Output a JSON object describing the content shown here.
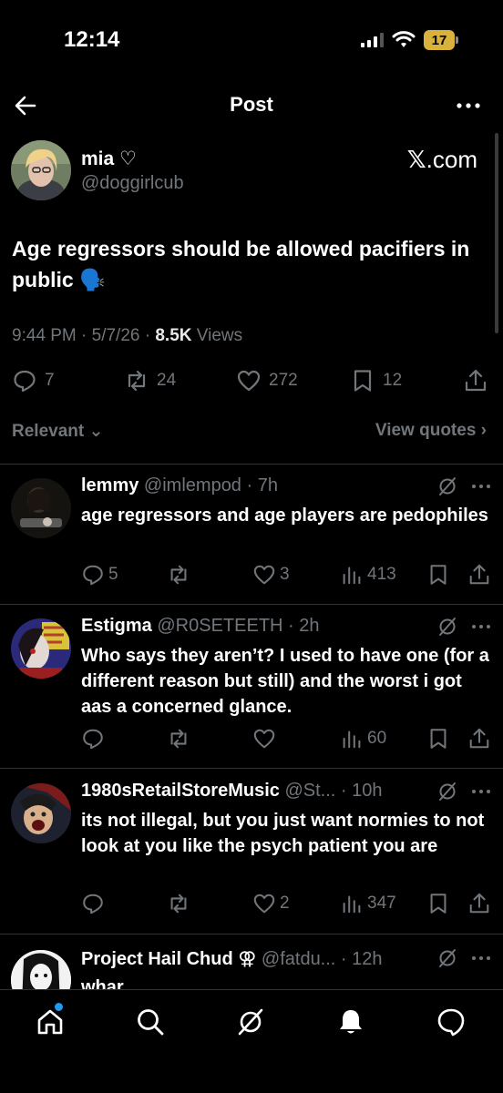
{
  "status_bar": {
    "time": "12:14",
    "battery": "17"
  },
  "header": {
    "title": "Post"
  },
  "post": {
    "author_name": "mia ♡",
    "author_handle": "@doggirlcub",
    "source": ".com",
    "source_glyph": "𝕏",
    "text": "Age regressors should be allowed pacifiers in public 🗣️",
    "time": "9:44 PM · 5/7/26 · ",
    "views_count": "8.5K",
    "views_label": " Views",
    "replies": "7",
    "reposts": "24",
    "likes": "272",
    "bookmarks": "12"
  },
  "sort": {
    "relevant_label": "Relevant",
    "view_quotes_label": "View quotes"
  },
  "replies": [
    {
      "name": "lemmy",
      "handle": " @imlempod · 7h",
      "text": "age regressors and age players are pedophiles",
      "replies": "5",
      "reposts": "",
      "likes": "3",
      "views": "413"
    },
    {
      "name": "Estigma",
      "handle": " @R0SETEETH · 2h",
      "text": "Who says they aren’t? I used to have one (for a different reason but still) and the worst i got aas a concerned glance.",
      "replies": "",
      "reposts": "",
      "likes": "",
      "views": "60"
    },
    {
      "name": "1980sRetailStoreMusic",
      "handle": " @St... · 10h",
      "text": "its not illegal, but you just want normies to not look at you like the psych patient you are",
      "replies": "",
      "reposts": "",
      "likes": "2",
      "views": "347"
    },
    {
      "name": "Project Hail Chud ⚢",
      "handle": " @fatdu... · 12h",
      "text": "whar"
    }
  ],
  "colors": {
    "background": "#000000",
    "text": "#e7e9ea",
    "muted": "#71767b",
    "accent": "#1d9bf0",
    "battery": "#d8b23a"
  },
  "icons": [
    "back-arrow-icon",
    "more-icon",
    "reply-icon",
    "repost-icon",
    "like-icon",
    "bookmark-icon",
    "share-icon",
    "views-icon",
    "grok-icon",
    "home-icon",
    "search-icon",
    "notifications-icon",
    "messages-icon"
  ]
}
